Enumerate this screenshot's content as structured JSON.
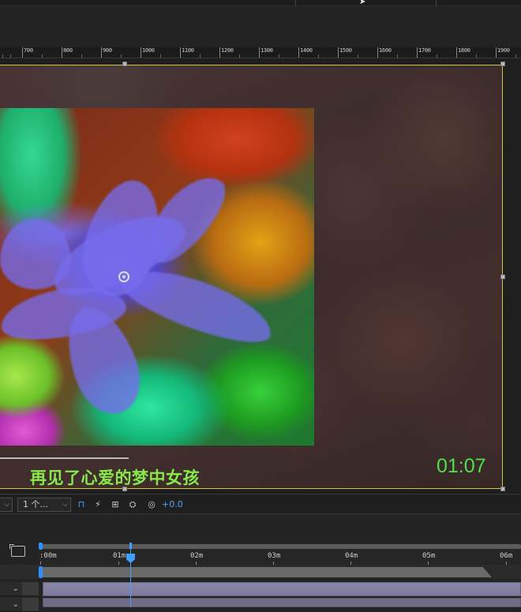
{
  "ruler": {
    "labels": [
      "700",
      "800",
      "900",
      "1000",
      "1100",
      "1200",
      "1300",
      "1400",
      "1500",
      "1600",
      "1700",
      "1800",
      "1900"
    ]
  },
  "viewer": {
    "subtitle": "再见了心爱的梦中女孩",
    "timecode": "01:07"
  },
  "toolbar": {
    "view_select": "",
    "views_select": "1 个...",
    "exposure": "+0.0"
  },
  "timeline": {
    "time_labels": [
      ":00m",
      "01m",
      "02m",
      "03m",
      "04m",
      "05m",
      "06m"
    ],
    "accent": "#3fa0ff"
  },
  "colors": {
    "subtitle": "#88e84a",
    "timecode": "#4fe04a",
    "comp_frame": "#d6c43a"
  }
}
